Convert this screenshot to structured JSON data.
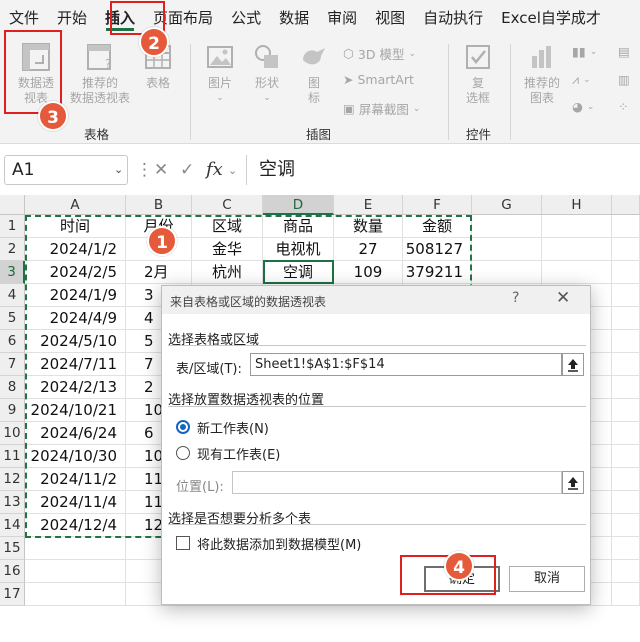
{
  "menu": {
    "tabs": [
      "文件",
      "开始",
      "插入",
      "页面布局",
      "公式",
      "数据",
      "审阅",
      "视图",
      "自动执行",
      "Excel自学成才"
    ],
    "active_tab": "插入"
  },
  "ribbon": {
    "pivot_table": "数据透\n视表",
    "recommended_pivot": "推荐的\n数据透视表",
    "table": "表格",
    "group_tables": "表格",
    "pictures": "图片",
    "shapes": "形状",
    "icons": "图\n标",
    "models_3d": "3D 模型",
    "smartart": "SmartArt",
    "screenshot": "屏幕截图",
    "group_illustrations": "插图",
    "checkbox": "复\n选框",
    "group_controls": "控件",
    "recommended_charts": "推荐的\n图表"
  },
  "formula_bar": {
    "name_box": "A1",
    "fx": "fx",
    "value": "空调"
  },
  "sheet": {
    "columns": [
      "A",
      "B",
      "C",
      "D",
      "E",
      "F",
      "G",
      "H"
    ],
    "rows": [
      "1",
      "2",
      "3",
      "4",
      "5",
      "6",
      "7",
      "8",
      "9",
      "10",
      "11",
      "12",
      "13",
      "14",
      "15",
      "16",
      "17"
    ],
    "headers": [
      "时间",
      "月份",
      "区域",
      "商品",
      "数量",
      "金额"
    ],
    "data": [
      {
        "time": "2024/1/2",
        "month": "",
        "region": "金华",
        "product": "电视机",
        "qty": "27",
        "amount": "508127"
      },
      {
        "time": "2024/2/5",
        "month": "2月",
        "region": "杭州",
        "product": "空调",
        "qty": "109",
        "amount": "379211"
      },
      {
        "time": "2024/1/9",
        "month": "3",
        "region": "",
        "product": "",
        "qty": "",
        "amount": ""
      },
      {
        "time": "2024/4/9",
        "month": "4",
        "region": "",
        "product": "",
        "qty": "",
        "amount": ""
      },
      {
        "time": "2024/5/10",
        "month": "5",
        "region": "",
        "product": "",
        "qty": "",
        "amount": ""
      },
      {
        "time": "2024/7/11",
        "month": "7",
        "region": "",
        "product": "",
        "qty": "",
        "amount": ""
      },
      {
        "time": "2024/2/13",
        "month": "2",
        "region": "",
        "product": "",
        "qty": "",
        "amount": ""
      },
      {
        "time": "2024/10/21",
        "month": "10",
        "region": "",
        "product": "",
        "qty": "",
        "amount": ""
      },
      {
        "time": "2024/6/24",
        "month": "6",
        "region": "",
        "product": "",
        "qty": "",
        "amount": ""
      },
      {
        "time": "2024/10/30",
        "month": "10",
        "region": "",
        "product": "",
        "qty": "",
        "amount": ""
      },
      {
        "time": "2024/11/2",
        "month": "11",
        "region": "",
        "product": "",
        "qty": "",
        "amount": ""
      },
      {
        "time": "2024/11/4",
        "month": "11",
        "region": "",
        "product": "",
        "qty": "",
        "amount": ""
      },
      {
        "time": "2024/12/4",
        "month": "12",
        "region": "",
        "product": "",
        "qty": "",
        "amount": ""
      }
    ]
  },
  "dialog": {
    "title": "来自表格或区域的数据透视表",
    "help": "?",
    "close": "✕",
    "section_source": "选择表格或区域",
    "range_label": "表/区域(T):",
    "range_value": "Sheet1!$A$1:$F$14",
    "section_location": "选择放置数据透视表的位置",
    "option_new": "新工作表(N)",
    "option_existing": "现有工作表(E)",
    "location_label": "位置(L):",
    "location_value": "",
    "section_multi": "选择是否想要分析多个表",
    "add_to_model": "将此数据添加到数据模型(M)",
    "ok": "确定",
    "cancel": "取消"
  },
  "annotations": {
    "step1": "1",
    "step2": "2",
    "step3": "3",
    "step4": "4",
    "color": "#e65a3c"
  },
  "colors": {
    "excel_green": "#1e7145",
    "highlight_red": "#e02020",
    "radio_blue": "#1565c0"
  }
}
